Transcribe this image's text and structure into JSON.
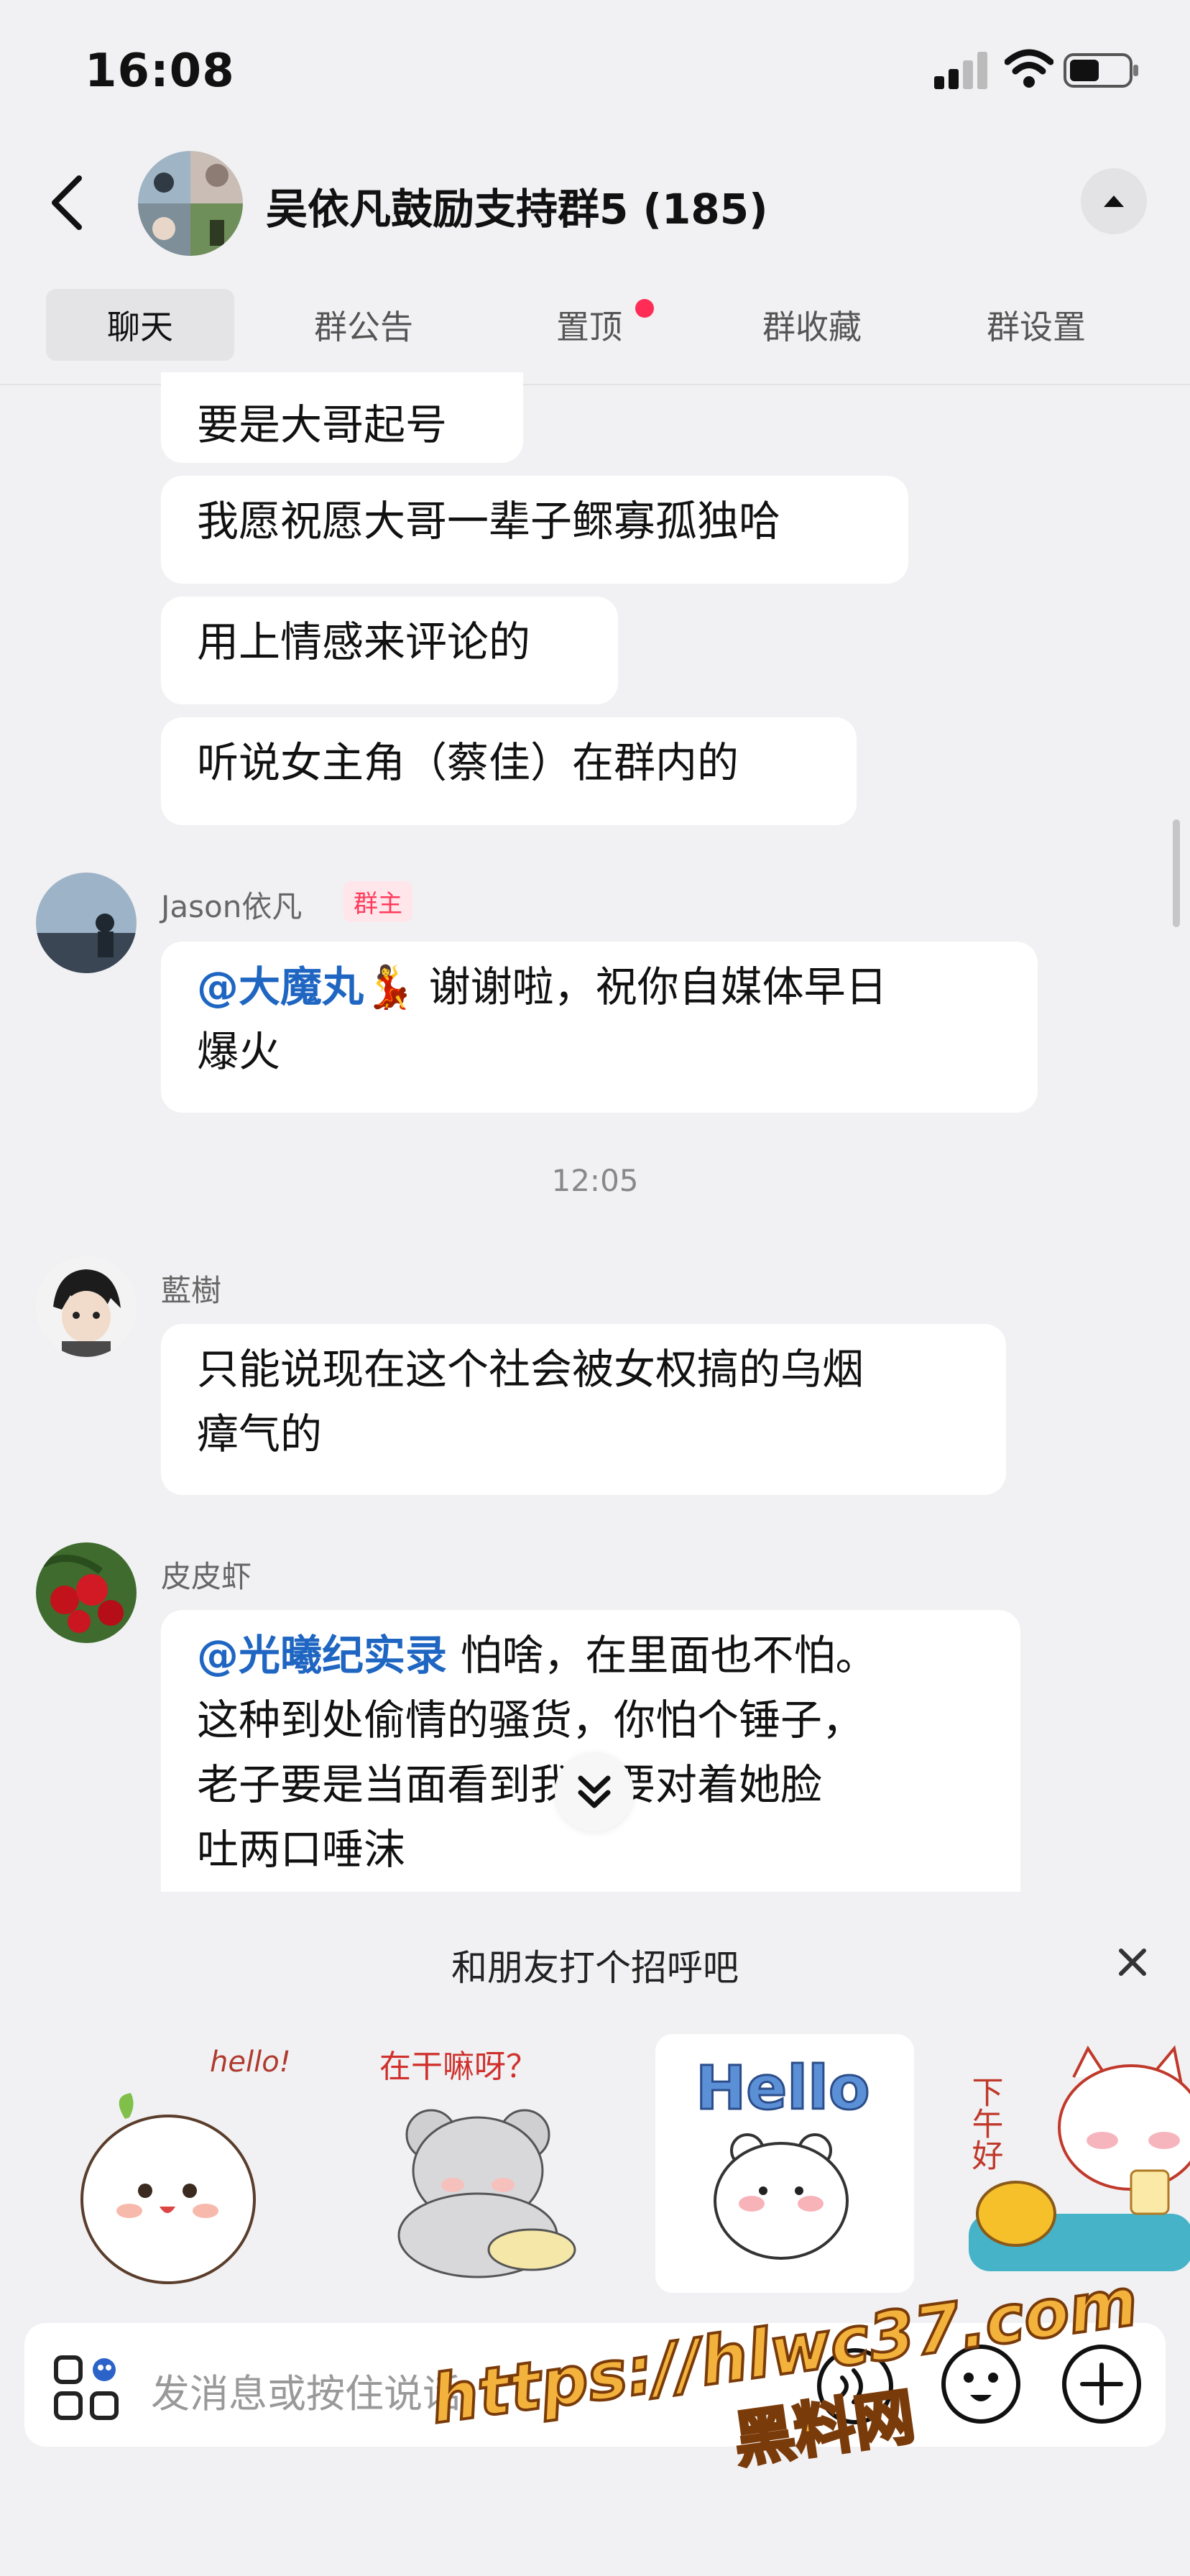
{
  "status_bar": {
    "time": "16:08"
  },
  "header": {
    "title": "吴依凡鼓励支持群5 (185)"
  },
  "tabs": [
    {
      "label": "聊天",
      "active": true
    },
    {
      "label": "群公告",
      "active": false
    },
    {
      "label": "置顶",
      "active": false,
      "has_dot": true
    },
    {
      "label": "群收藏",
      "active": false
    },
    {
      "label": "群设置",
      "active": false
    }
  ],
  "messages": {
    "m1": "要是大哥起号",
    "m2": "我愿祝愿大哥一辈子鳏寡孤独哈",
    "m3": "用上情感来评论的",
    "m4": "听说女主角（蔡佳）在群内的",
    "jason": {
      "sender": "Jason依凡",
      "badge": "群主",
      "mention": "@大魔丸",
      "line1": " 谢谢啦，祝你自媒体早日",
      "line2": "爆火"
    },
    "time_sep": "12:05",
    "lanshu": {
      "sender": "藍樹",
      "line1": "只能说现在这个社会被女权搞的乌烟",
      "line2": "瘴气的"
    },
    "pipixia": {
      "sender": "皮皮虾",
      "mention": "@光曦纪实录",
      "line1": " 怕啥，在里面也不怕。",
      "line2": "这种到处偷情的骚货，你怕个锤子，",
      "line3": "老子要是当面看到我还要对着她脸",
      "line4": "吐两口唾沫"
    }
  },
  "greeting": {
    "title": "和朋友打个招呼吧",
    "stickers": [
      {
        "icon": "sticker-hello-mochi",
        "text": "hello!"
      },
      {
        "icon": "sticker-koala",
        "text": "在干嘛呀？"
      },
      {
        "icon": "sticker-hello-bear",
        "text": "Hello"
      },
      {
        "icon": "sticker-afternoon-cat",
        "text": "下午好"
      }
    ]
  },
  "input": {
    "placeholder": "发消息或按住说话"
  },
  "watermark": {
    "url": "https://hlwc37.com",
    "name": "黑料网"
  },
  "colors": {
    "mention": "#1f66c2",
    "badge": "#ff3b5c",
    "background": "#f1f1f3"
  }
}
